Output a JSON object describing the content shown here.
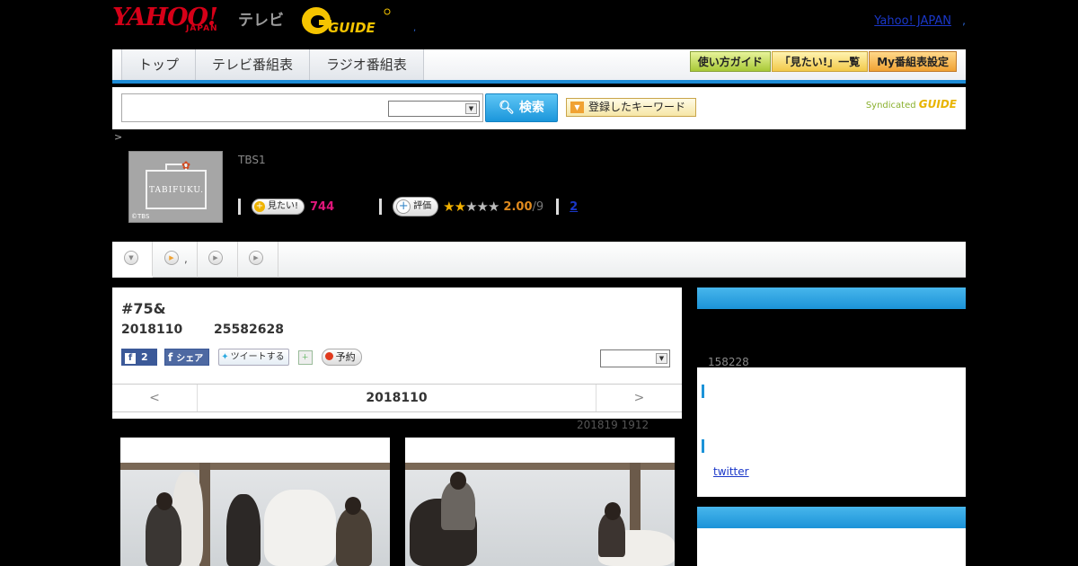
{
  "header": {
    "logo_yahoo": "YAHOO!",
    "logo_japan": "JAPAN",
    "logo_tv": "テレビ",
    "logo_gguide": "GUIDE",
    "dot": ",",
    "yahoo_japan_link": "Yahoo! JAPAN",
    "yahoo_japan_dot": ","
  },
  "nav": {
    "tabs": [
      {
        "label": "トップ"
      },
      {
        "label": "テレビ番組表"
      },
      {
        "label": "ラジオ番組表"
      }
    ],
    "buttons": [
      {
        "label": "使い方ガイド"
      },
      {
        "label": "「見たい!」一覧"
      },
      {
        "label": "My番組表設定"
      }
    ]
  },
  "search": {
    "placeholder": "",
    "button_label": "検索",
    "keyword_button": "登録したキーワード",
    "syndicated": "Syndicated",
    "syndicated_brand": "GUIDE"
  },
  "program": {
    "breadcrumb": ">",
    "channel": "TBS1",
    "thumb_text": "TABIFUKU.",
    "thumb_copyright": "©TBS",
    "mitai_label": "見たい!",
    "mitai_count": "744",
    "hyoka_label": "評価",
    "rating_stars_on": 2,
    "rating_stars_total": 5,
    "rating_score": "2.00",
    "rating_denominator": "/9",
    "review_link": "2"
  },
  "tabbar": {
    "tab2_text": ","
  },
  "main": {
    "title": "#75&",
    "date": "2018110",
    "time": "25582628",
    "fb_count": "2",
    "fb_share": "シェア",
    "tweet": "ツイートする",
    "reserve": "予約",
    "pager_prev": "<",
    "pager_current": "2018110",
    "pager_next": ">",
    "updated": "201819  1912"
  },
  "sidebar": {
    "number": "158228",
    "twitter_link": "twitter"
  },
  "colors": {
    "accent_blue": "#1d8bd6",
    "yahoo_red": "#d60018",
    "mitai_pink": "#e0167b",
    "star_gold": "#f2b100"
  }
}
